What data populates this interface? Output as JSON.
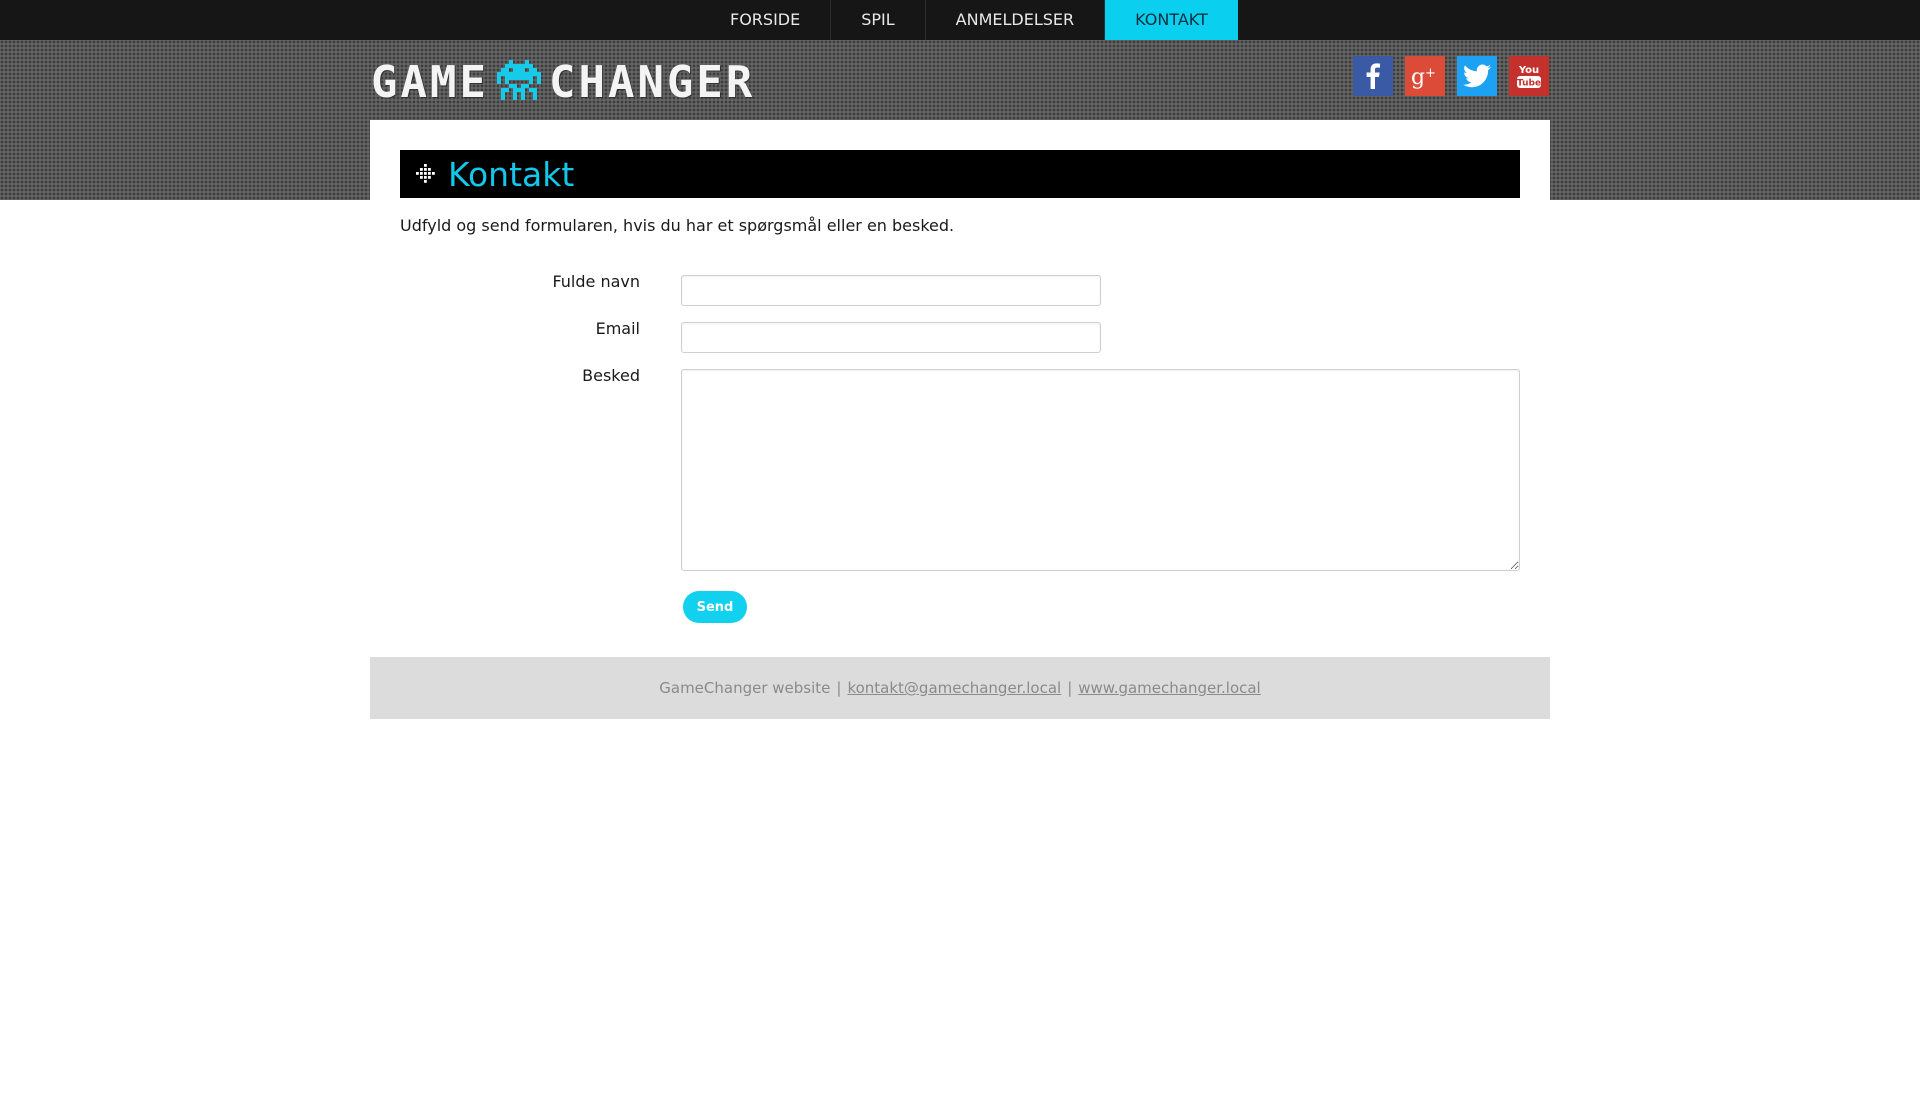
{
  "nav": {
    "items": [
      {
        "label": "FORSIDE",
        "active": false
      },
      {
        "label": "SPIL",
        "active": false
      },
      {
        "label": "ANMELDELSER",
        "active": false
      },
      {
        "label": "KONTAKT",
        "active": true
      }
    ]
  },
  "header": {
    "logo_left": "GAME",
    "logo_right": "CHANGER",
    "social": [
      {
        "name": "facebook-icon",
        "glyph": "f",
        "color": "#3b5aa6"
      },
      {
        "name": "google-plus-icon",
        "glyph": "g+",
        "color": "#dc4a38"
      },
      {
        "name": "twitter-icon",
        "glyph": "bird",
        "color": "#1da1f2"
      },
      {
        "name": "youtube-icon",
        "glyph": "You Tube",
        "color": "#c4302b"
      }
    ]
  },
  "page": {
    "title": "Kontakt",
    "intro": "Udfyld og send formularen, hvis du har et spørgsmål eller en besked."
  },
  "form": {
    "name_label": "Fulde navn",
    "name_value": "",
    "email_label": "Email",
    "email_value": "",
    "message_label": "Besked",
    "message_value": "",
    "send_label": "Send"
  },
  "footer": {
    "site": "GameChanger website",
    "separator": "|",
    "email": "kontakt@gamechanger.local",
    "url": "www.gamechanger.local"
  },
  "colors": {
    "accent": "#0bcfee",
    "nav_bg": "#161616",
    "footer_bg": "#dcdcdc"
  }
}
